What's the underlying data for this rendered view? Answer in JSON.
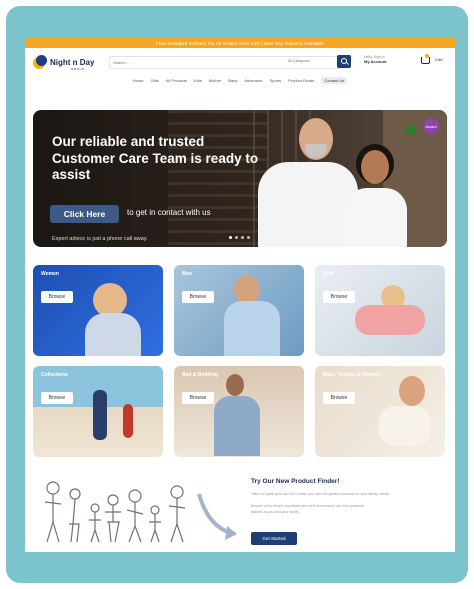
{
  "promo": {
    "text": "Free Standard Delivery On All Orders Over £40 | Next Day Delivery Available"
  },
  "header": {
    "logo_text": "Night n Day",
    "logo_sub": "GROUP",
    "search_placeholder": "Search...",
    "search_category": "All Categories",
    "account_hello": "Hello, Sign in",
    "account_label": "My Account",
    "cart_label": "Cart"
  },
  "nav": {
    "items": [
      "Home",
      "Gifts",
      "All Products",
      "Kids",
      "Mother",
      "Baby",
      "Adventure",
      "Sports",
      "Product Finder",
      "Contact Us"
    ]
  },
  "hero": {
    "title": "Our reliable and trusted Customer Care Team is ready to assist",
    "cta": "Click Here",
    "cta_text": "to get in contact with us",
    "note": "Expert advice is just a phone call away.",
    "badge": "Award"
  },
  "tiles": [
    {
      "label": "Women",
      "button": "Browse"
    },
    {
      "label": "Men",
      "button": "Browse"
    },
    {
      "label": "Kids",
      "button": "Browse"
    },
    {
      "label": "Collections",
      "button": "Browse"
    },
    {
      "label": "Bed & Bedding",
      "button": "Browse"
    },
    {
      "label": "Baby, Toddler & Nursery",
      "button": "Browse"
    }
  ],
  "finder": {
    "title": "Try Our New Product Finder!",
    "line1": "Take our quick quiz and we'll match you with the perfect products for your family needs.",
    "line2": "Answer a few simple questions and we'll recommend our best products",
    "line3": "tailored to you and your family.",
    "button": "Get Started"
  },
  "colors": {
    "accent": "#f5a623",
    "primary": "#1d3f73",
    "frame": "#7cc4cc"
  }
}
